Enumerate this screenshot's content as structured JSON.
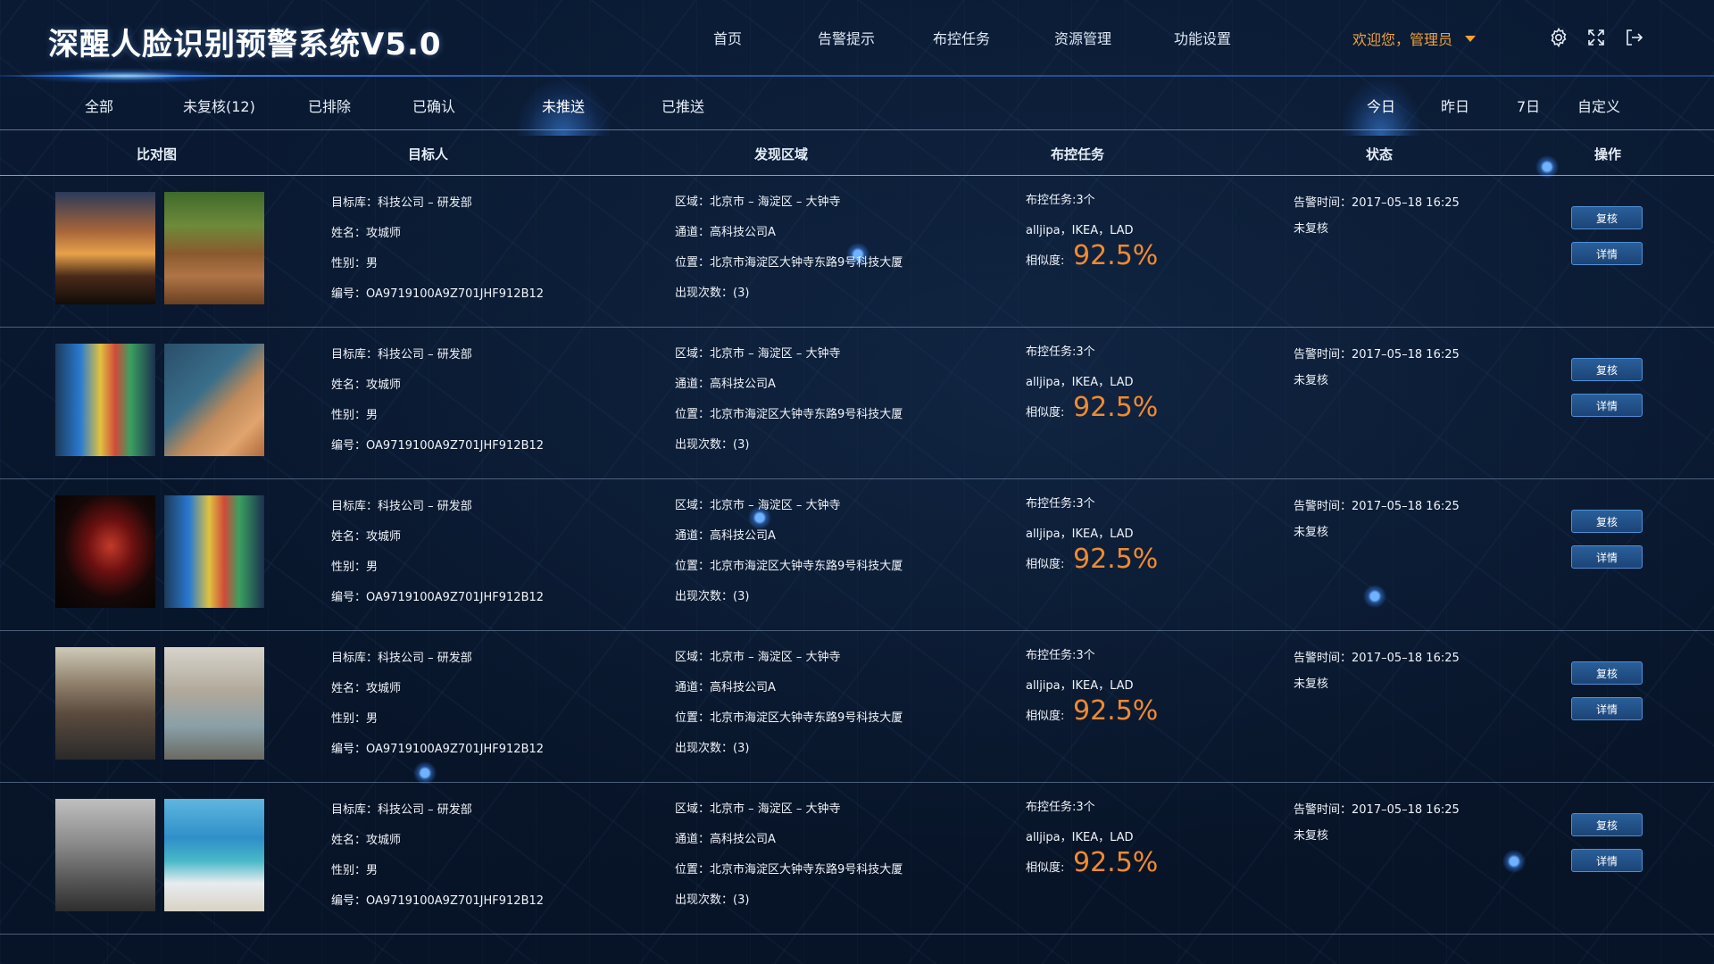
{
  "app": {
    "title": "深醒人脸识别预警系统V5.0"
  },
  "nav": [
    {
      "label": "首页"
    },
    {
      "label": "告警提示"
    },
    {
      "label": "布控任务"
    },
    {
      "label": "资源管理"
    },
    {
      "label": "功能设置"
    }
  ],
  "user": {
    "welcome": "欢迎您，管理员"
  },
  "filters": {
    "tabs": [
      {
        "label": "全部"
      },
      {
        "label": "未复核(12)"
      },
      {
        "label": "已排除"
      },
      {
        "label": "已确认"
      },
      {
        "label": "未推送",
        "active": true
      },
      {
        "label": "已推送"
      }
    ],
    "dates": [
      {
        "label": "今日",
        "active": true
      },
      {
        "label": "昨日"
      },
      {
        "label": "7日"
      },
      {
        "label": "自定义"
      }
    ]
  },
  "columns": [
    "比对图",
    "目标人",
    "发现区域",
    "布控任务",
    "状态",
    "操作"
  ],
  "records": [
    {
      "target_lib": "目标库：科技公司 – 研发部",
      "name": "姓名：攻城师",
      "gender": "性别：男",
      "id": "编号：OA9719100A9Z701JHF912B12",
      "area": "区域：北京市 – 海淀区 – 大钟寺",
      "channel": "通道：高科技公司A",
      "location": "位置：北京市海淀区大钟寺东路9号科技大厦",
      "count": "出现次数：(3)",
      "tasks": "布控任务:3个",
      "task_names": "alljipa，IKEA，LAD",
      "similarity_label": "相似度:",
      "similarity": "92.5%",
      "alarm_time": "告警时间：2017–05–18 16:25",
      "status": "未复核",
      "review_btn": "复核",
      "detail_btn": "详情",
      "photo_a": "sunset-hand",
      "photo_b": "children-running"
    },
    {
      "target_lib": "目标库：科技公司 – 研发部",
      "name": "姓名：攻城师",
      "gender": "性别：男",
      "id": "编号：OA9719100A9Z701JHF912B12",
      "area": "区域：北京市 – 海淀区 – 大钟寺",
      "channel": "通道：高科技公司A",
      "location": "位置：北京市海淀区大钟寺东路9号科技大厦",
      "count": "出现次数：(3)",
      "tasks": "布控任务:3个",
      "task_names": "alljipa，IKEA，LAD",
      "similarity_label": "相似度:",
      "similarity": "92.5%",
      "alarm_time": "告警时间：2017–05–18 16:25",
      "status": "未复核",
      "review_btn": "复核",
      "detail_btn": "详情",
      "photo_a": "toy-blocks",
      "photo_b": "hand-toy"
    },
    {
      "target_lib": "目标库：科技公司 – 研发部",
      "name": "姓名：攻城师",
      "gender": "性别：男",
      "id": "编号：OA9719100A9Z701JHF912B12",
      "area": "区域：北京市 – 海淀区 – 大钟寺",
      "channel": "通道：高科技公司A",
      "location": "位置：北京市海淀区大钟寺东路9号科技大厦",
      "count": "出现次数：(3)",
      "tasks": "布控任务:3个",
      "task_names": "alljipa，IKEA，LAD",
      "similarity_label": "相似度:",
      "similarity": "92.5%",
      "alarm_time": "告警时间：2017–05–18 16:25",
      "status": "未复核",
      "review_btn": "复核",
      "detail_btn": "详情",
      "photo_a": "dark-portrait",
      "photo_b": "toy-blocks"
    },
    {
      "target_lib": "目标库：科技公司 – 研发部",
      "name": "姓名：攻城师",
      "gender": "性别：男",
      "id": "编号：OA9719100A9Z701JHF912B12",
      "area": "区域：北京市 – 海淀区 – 大钟寺",
      "channel": "通道：高科技公司A",
      "location": "位置：北京市海淀区大钟寺东路9号科技大厦",
      "count": "出现次数：(3)",
      "tasks": "布控任务:3个",
      "task_names": "alljipa，IKEA，LAD",
      "similarity_label": "相似度:",
      "similarity": "92.5%",
      "alarm_time": "告警时间：2017–05–18 16:25",
      "status": "未复核",
      "review_btn": "复核",
      "detail_btn": "详情",
      "photo_a": "father-child-hug",
      "photo_b": "father-child-play"
    },
    {
      "target_lib": "目标库：科技公司 – 研发部",
      "name": "姓名：攻城师",
      "gender": "性别：男",
      "id": "编号：OA9719100A9Z701JHF912B12",
      "area": "区域：北京市 – 海淀区 – 大钟寺",
      "channel": "通道：高科技公司A",
      "location": "位置：北京市海淀区大钟寺东路9号科技大厦",
      "count": "出现次数：(3)",
      "tasks": "布控任务:3个",
      "task_names": "alljipa，IKEA，LAD",
      "similarity_label": "相似度:",
      "similarity": "92.5%",
      "alarm_time": "告警时间：2017–05–18 16:25",
      "status": "未复核",
      "review_btn": "复核",
      "detail_btn": "详情",
      "photo_a": "couple-walking-path",
      "photo_b": "beach-child"
    }
  ],
  "colors": {
    "accent": "#f0a23a",
    "similarity": "#f08a30",
    "button": "#1f4f87",
    "background": "#081428"
  }
}
